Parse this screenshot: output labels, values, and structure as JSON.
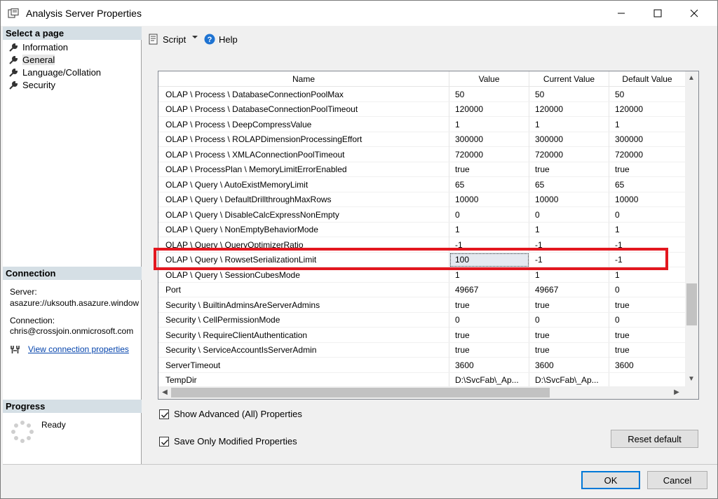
{
  "window": {
    "title": "Analysis Server Properties"
  },
  "left_pane": {
    "select_page_header": "Select a page",
    "pages": [
      {
        "label": "Information"
      },
      {
        "label": "General",
        "selected": true
      },
      {
        "label": "Language/Collation"
      },
      {
        "label": "Security"
      }
    ],
    "connection_header": "Connection",
    "server_label": "Server:",
    "server_value": "asazure://uksouth.asazure.window",
    "connection_label": "Connection:",
    "connection_value": "chris@crossjoin.onmicrosoft.com",
    "view_connection_link": "View connection properties",
    "progress_header": "Progress",
    "progress_status": "Ready"
  },
  "toolbar": {
    "script_label": "Script",
    "help_label": "Help"
  },
  "grid": {
    "columns": [
      "Name",
      "Value",
      "Current Value",
      "Default Value"
    ],
    "rows": [
      {
        "name": "OLAP \\ Process \\ DatabaseConnectionPoolMax",
        "value": "50",
        "current": "50",
        "default": "50"
      },
      {
        "name": "OLAP \\ Process \\ DatabaseConnectionPoolTimeout",
        "value": "120000",
        "current": "120000",
        "default": "120000"
      },
      {
        "name": "OLAP \\ Process \\ DeepCompressValue",
        "value": "1",
        "current": "1",
        "default": "1"
      },
      {
        "name": "OLAP \\ Process \\ ROLAPDimensionProcessingEffort",
        "value": "300000",
        "current": "300000",
        "default": "300000"
      },
      {
        "name": "OLAP \\ Process \\ XMLAConnectionPoolTimeout",
        "value": "720000",
        "current": "720000",
        "default": "720000"
      },
      {
        "name": "OLAP \\ ProcessPlan \\ MemoryLimitErrorEnabled",
        "value": "true",
        "current": "true",
        "default": "true"
      },
      {
        "name": "OLAP \\ Query \\ AutoExistMemoryLimit",
        "value": "65",
        "current": "65",
        "default": "65"
      },
      {
        "name": "OLAP \\ Query \\ DefaultDrillthroughMaxRows",
        "value": "10000",
        "current": "10000",
        "default": "10000"
      },
      {
        "name": "OLAP \\ Query \\ DisableCalcExpressNonEmpty",
        "value": "0",
        "current": "0",
        "default": "0"
      },
      {
        "name": "OLAP \\ Query \\ NonEmptyBehaviorMode",
        "value": "1",
        "current": "1",
        "default": "1"
      },
      {
        "name": "OLAP \\ Query \\ QueryOptimizerRatio",
        "value": "-1",
        "current": "-1",
        "default": "-1"
      },
      {
        "name": "OLAP \\ Query \\ RowsetSerializationLimit",
        "value": "100",
        "current": "-1",
        "default": "-1",
        "editing": true
      },
      {
        "name": "OLAP \\ Query \\ SessionCubesMode",
        "value": "1",
        "current": "1",
        "default": "1"
      },
      {
        "name": "Port",
        "value": "49667",
        "current": "49667",
        "default": "0"
      },
      {
        "name": "Security \\ BuiltinAdminsAreServerAdmins",
        "value": "true",
        "current": "true",
        "default": "true"
      },
      {
        "name": "Security \\ CellPermissionMode",
        "value": "0",
        "current": "0",
        "default": "0"
      },
      {
        "name": "Security \\ RequireClientAuthentication",
        "value": "true",
        "current": "true",
        "default": "true"
      },
      {
        "name": "Security \\ ServiceAccountIsServerAdmin",
        "value": "true",
        "current": "true",
        "default": "true"
      },
      {
        "name": "ServerTimeout",
        "value": "3600",
        "current": "3600",
        "default": "3600"
      },
      {
        "name": "TempDir",
        "value": "D:\\SvcFab\\_Ap...",
        "current": "D:\\SvcFab\\_Ap...",
        "default": ""
      }
    ]
  },
  "options": {
    "show_advanced_label": "Show Advanced (All) Properties",
    "show_advanced_checked": true,
    "save_only_modified_label": "Save Only Modified Properties",
    "save_only_modified_checked": true
  },
  "buttons": {
    "reset_default": "Reset default",
    "ok": "OK",
    "cancel": "Cancel"
  },
  "colors": {
    "highlight": "#e3171f",
    "section_header": "#d5dfe5",
    "link": "#0645ad",
    "ok_border": "#0078d7"
  }
}
